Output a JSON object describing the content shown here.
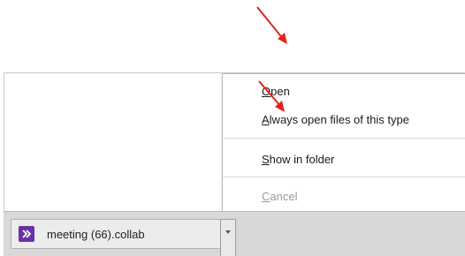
{
  "download_shelf": {
    "file_name": "meeting (66).collab",
    "file_icon": "collab-file-icon",
    "menu_button_icon": "chevron-down-icon"
  },
  "context_menu": {
    "items": [
      {
        "accel": "O",
        "rest": "pen",
        "enabled": true
      },
      {
        "accel": "A",
        "rest": "lways open files of this type",
        "enabled": true
      },
      {
        "accel": "S",
        "rest": "how in folder",
        "enabled": true
      },
      {
        "accel": "C",
        "rest": "ancel",
        "enabled": false
      }
    ]
  },
  "annotations": {
    "arrow_color": "#e8201c"
  },
  "colors": {
    "file_icon_bg": "#6b2fa6",
    "shelf_bg": "#d8d8d8",
    "disabled_text": "#9a9a9a"
  }
}
